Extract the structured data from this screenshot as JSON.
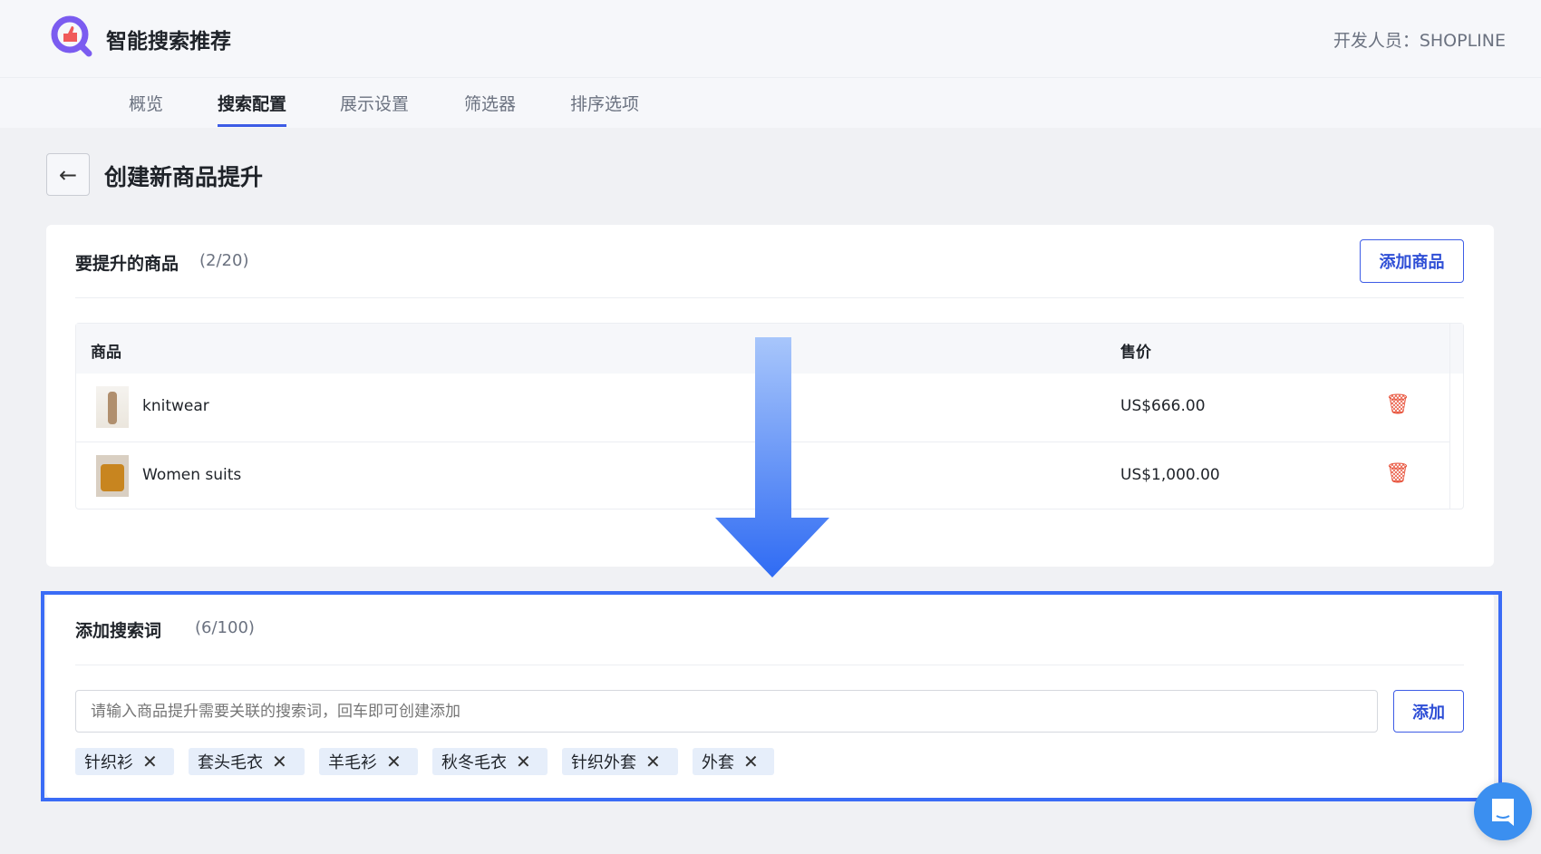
{
  "app": {
    "title": "智能搜索推荐",
    "developer": "开发人员：SHOPLINE"
  },
  "tabs": [
    "概览",
    "搜索配置",
    "展示设置",
    "筛选器",
    "排序选项"
  ],
  "page": {
    "title": "创建新商品提升"
  },
  "products": {
    "title": "要提升的商品",
    "count": "(2/20)",
    "add_label": "添加商品",
    "col_product": "商品",
    "col_price": "售价",
    "rows": [
      {
        "name": "knitwear",
        "price": "US$666.00"
      },
      {
        "name": "Women suits",
        "price": "US$1,000.00"
      }
    ]
  },
  "keywords": {
    "title": "添加搜索词",
    "count": "(6/100)",
    "placeholder": "请输入商品提升需要关联的搜索词，回车即可创建添加",
    "add_label": "添加",
    "tags": [
      "针织衫",
      "套头毛衣",
      "羊毛衫",
      "秋冬毛衣",
      "针织外套",
      "外套"
    ]
  },
  "colors": {
    "accent": "#3d5ce6",
    "highlight": "#3a6cf6",
    "delete": "#e8553e",
    "chat": "#3b8ff0"
  }
}
